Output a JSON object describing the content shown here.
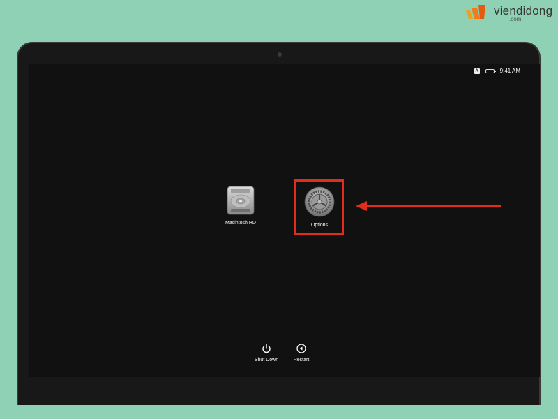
{
  "watermark": {
    "brand": "viendidong",
    "sub": ".com"
  },
  "status_bar": {
    "keyboard_badge": "A",
    "time": "9:41 AM"
  },
  "startup_options": [
    {
      "label": "Macintosh HD",
      "icon": "hard-drive-icon"
    },
    {
      "label": "Options",
      "icon": "gear-icon"
    }
  ],
  "bottom_buttons": [
    {
      "label": "Shut Down",
      "icon": "power-icon"
    },
    {
      "label": "Restart",
      "icon": "restart-icon"
    }
  ],
  "colors": {
    "highlight": "#e22d1c",
    "background": "#8fd1b5",
    "screen": "#111111"
  }
}
